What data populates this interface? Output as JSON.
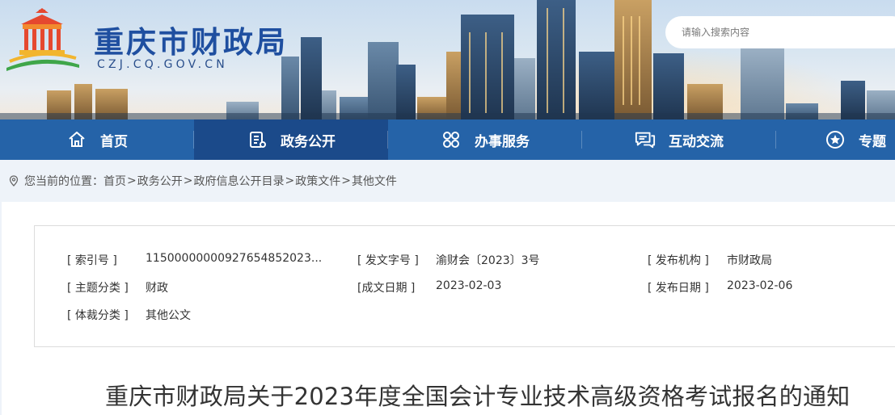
{
  "header": {
    "site_title": "重庆市财政局",
    "site_domain": "CZJ.CQ.GOV.CN",
    "search": {
      "placeholder": "请输入搜索内容"
    }
  },
  "nav": {
    "items": [
      {
        "label": "首页",
        "icon": "home-icon"
      },
      {
        "label": "政务公开",
        "icon": "document-list-icon",
        "active": true
      },
      {
        "label": "办事服务",
        "icon": "grid-circles-icon"
      },
      {
        "label": "互动交流",
        "icon": "chat-icon"
      },
      {
        "label": "专题",
        "icon": "star-icon"
      }
    ]
  },
  "breadcrumb": {
    "prefix": "您当前的位置：",
    "items": [
      "首页",
      "政务公开",
      "政府信息公开目录",
      "政策文件",
      "其他文件"
    ],
    "separator": ">"
  },
  "doc_meta": {
    "index_label": "[ 索引号 ]",
    "index_value": "11500000000927654852023...",
    "doc_no_label": "[ 发文字号 ]",
    "doc_no_value": "渝财会〔2023〕3号",
    "issuer_label": "[ 发布机构 ]",
    "issuer_value": "市财政局",
    "topic_label": "[ 主题分类 ]",
    "topic_value": "财政",
    "written_label": "[成文日期 ]",
    "written_value": "2023-02-03",
    "published_label": "[ 发布日期 ]",
    "published_value": "2023-02-06",
    "genre_label": "[ 体裁分类 ]",
    "genre_value": "其他公文"
  },
  "document": {
    "title": "重庆市财政局关于2023年度全国会计专业技术高级资格考试报名的通知"
  },
  "colors": {
    "nav_bg": "#2563a8",
    "nav_active_bg": "#1b4a8a",
    "title_blue": "#1f4fa0"
  }
}
